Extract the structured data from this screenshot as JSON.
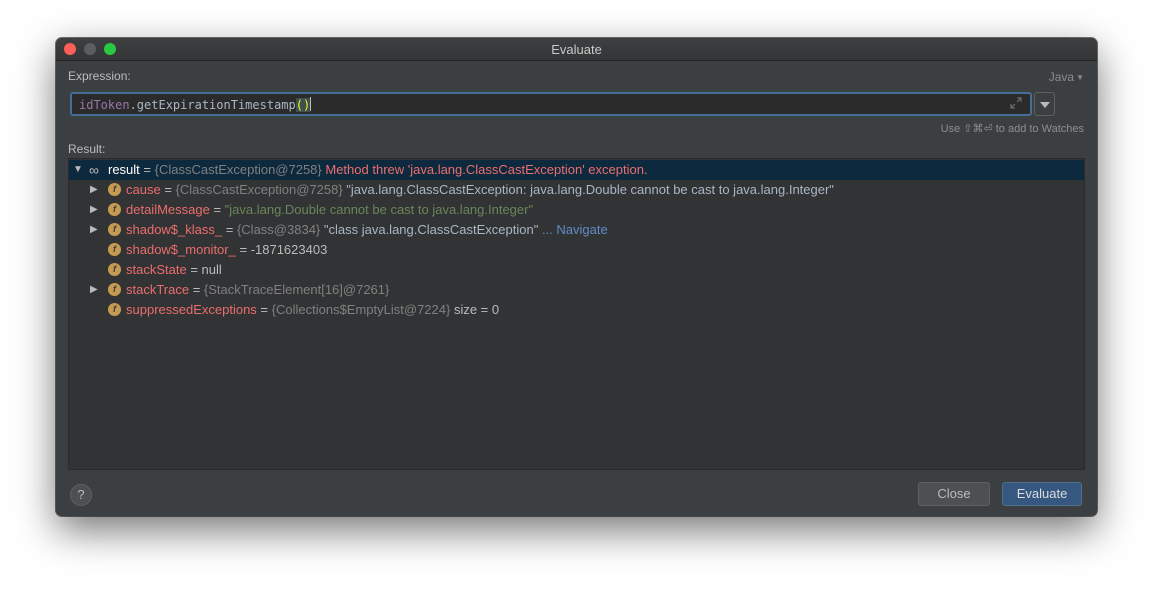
{
  "window": {
    "title": "Evaluate"
  },
  "expression": {
    "label": "Expression:",
    "language": "Java",
    "var_part": "idToken",
    "method_part": ".getExpirationTimestamp",
    "paren_part": "()",
    "hint": "Use ⇧⌘⏎ to add to Watches"
  },
  "result": {
    "label": "Result:",
    "root": {
      "name": "result",
      "eq": " = ",
      "ref": "{ClassCastException@7258}",
      "message": " Method threw 'java.lang.ClassCastException' exception."
    },
    "fields": [
      {
        "name": "cause",
        "eq": " = ",
        "ref": "{ClassCastException@7258}",
        "value": " \"java.lang.ClassCastException: java.lang.Double cannot be cast to java.lang.Integer\"",
        "expandable": true
      },
      {
        "name": "detailMessage",
        "eq": " = ",
        "ref": "",
        "value": "\"java.lang.Double cannot be cast to java.lang.Integer\"",
        "expandable": true
      },
      {
        "name": "shadow$_klass_",
        "eq": " = ",
        "ref": "{Class@3834}",
        "value": " \"class java.lang.ClassCastException\"",
        "link": " ... Navigate",
        "expandable": true
      },
      {
        "name": "shadow$_monitor_",
        "eq": " = ",
        "ref": "",
        "value": "-1871623403",
        "expandable": false
      },
      {
        "name": "stackState",
        "eq": " = ",
        "ref": "",
        "value": "null",
        "expandable": false
      },
      {
        "name": "stackTrace",
        "eq": " = ",
        "ref": "{StackTraceElement[16]@7261}",
        "value": "",
        "expandable": true
      },
      {
        "name": "suppressedExceptions",
        "eq": " = ",
        "ref": "{Collections$EmptyList@7224}",
        "value": "  size = 0",
        "expandable": false
      }
    ]
  },
  "buttons": {
    "help": "?",
    "close": "Close",
    "evaluate": "Evaluate"
  },
  "icons": {
    "field": "f",
    "watch": "∞",
    "expanded": "▼",
    "collapsed": "▶"
  },
  "colors": {
    "selection": "#0d293e",
    "error": "#ec6d6d",
    "string": "#6a8759",
    "link": "#5f8dc7",
    "primary_button": "#365880"
  }
}
